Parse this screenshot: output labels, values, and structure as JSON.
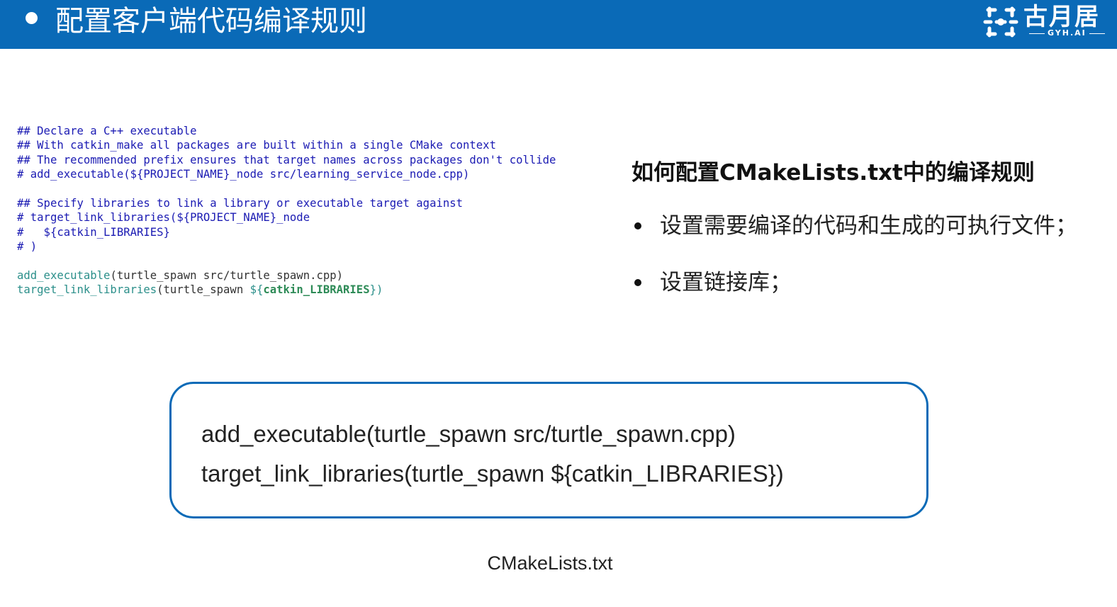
{
  "header": {
    "title": "配置客户端代码编译规则",
    "logo_text": "古月居",
    "logo_sub": "GYH.AI",
    "color": "#0a6ab7"
  },
  "code": {
    "lines": [
      "## Declare a C++ executable",
      "## With catkin_make all packages are built within a single CMake context",
      "## The recommended prefix ensures that target names across packages don't collide",
      "# add_executable(${PROJECT_NAME}_node src/learning_service_node.cpp)",
      "",
      "## Specify libraries to link a library or executable target against",
      "# target_link_libraries(${PROJECT_NAME}_node",
      "#   ${catkin_LIBRARIES}",
      "# )",
      ""
    ],
    "add_exec_fn": "add_executable",
    "add_exec_args": "(turtle_spawn src/turtle_spawn.cpp)",
    "link_fn": "target_link_libraries",
    "link_args": "(turtle_spawn ",
    "link_var_open": "${",
    "link_var": "catkin_LIBRARIES",
    "link_var_close": "})"
  },
  "right_panel": {
    "heading": "如何配置CMakeLists.txt中的编译规则",
    "bullets": [
      "设置需要编译的代码和生成的可执行文件；",
      "设置链接库；"
    ]
  },
  "box": {
    "line1": "add_executable(turtle_spawn src/turtle_spawn.cpp)",
    "line2": "target_link_libraries(turtle_spawn ${catkin_LIBRARIES})"
  },
  "caption": "CMakeLists.txt"
}
